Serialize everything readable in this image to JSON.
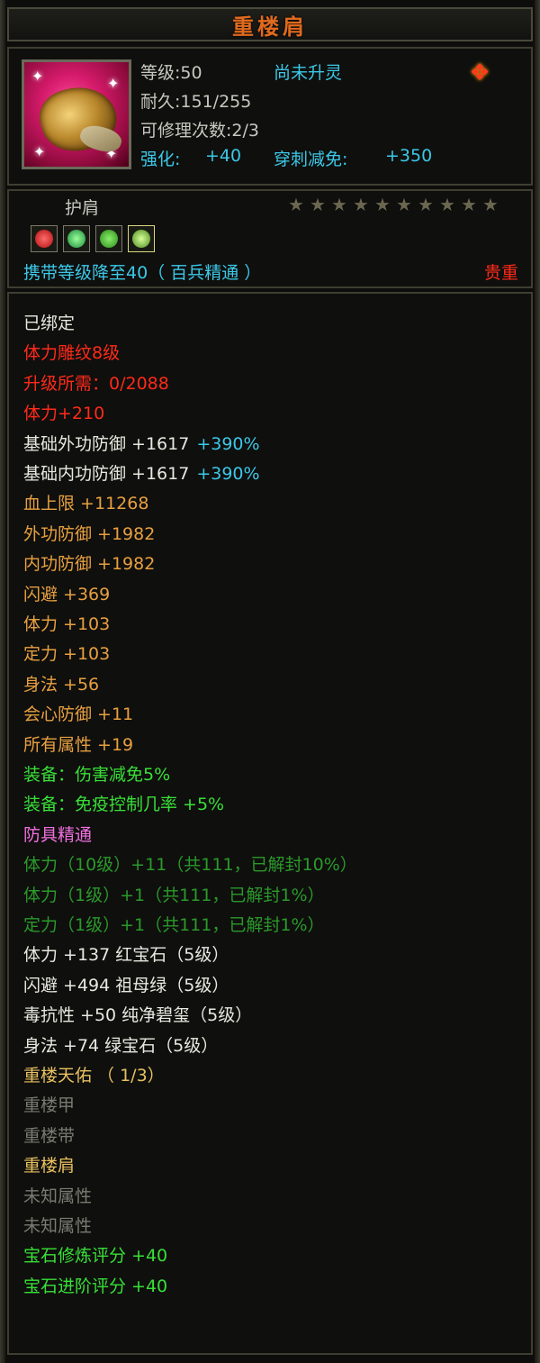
{
  "title": "重楼肩",
  "header": {
    "level_label": "等级:50",
    "spirit_status": "尚未升灵",
    "durability": "耐久:151/255",
    "repair_count": "可修理次数:2/3",
    "enhance_label": "强化:",
    "enhance_value": "+40",
    "pierce_label": "穿刺减免:",
    "pierce_value": "+350"
  },
  "slot": {
    "type_label": "护肩",
    "stars_filled": 0,
    "stars_total": 10,
    "carry_level_text": "携带等级降至40（ 百兵精通 ）",
    "rarity": "贵重",
    "gems": [
      "red-gem-icon",
      "green-gem-icon",
      "green-gem-icon",
      "jade-gem-icon"
    ]
  },
  "colors": {
    "title": "#e06a1e",
    "cyan": "#3cc8e8",
    "red": "#ff2a1a",
    "orange": "#e8a040",
    "green": "#38e038",
    "dark_green": "#2a9a2a",
    "pink": "#f070e0",
    "dim": "#7a7a72"
  },
  "attributes": [
    {
      "text": "已绑定",
      "extra": "",
      "color": "white"
    },
    {
      "text": "体力雕纹8级",
      "extra": "",
      "color": "red"
    },
    {
      "text": "升级所需：0/2088",
      "extra": "",
      "color": "red"
    },
    {
      "text": "体力+210",
      "extra": "",
      "color": "red"
    },
    {
      "text": "基础外功防御 +1617",
      "extra": "+390%",
      "color": "white"
    },
    {
      "text": "基础内功防御 +1617",
      "extra": "+390%",
      "color": "white"
    },
    {
      "text": "血上限 +11268",
      "extra": "",
      "color": "orange"
    },
    {
      "text": "外功防御 +1982",
      "extra": "",
      "color": "orange"
    },
    {
      "text": "内功防御 +1982",
      "extra": "",
      "color": "orange"
    },
    {
      "text": "闪避 +369",
      "extra": "",
      "color": "orange"
    },
    {
      "text": "体力 +103",
      "extra": "",
      "color": "orange"
    },
    {
      "text": "定力 +103",
      "extra": "",
      "color": "orange"
    },
    {
      "text": "身法 +56",
      "extra": "",
      "color": "orange"
    },
    {
      "text": "会心防御 +11",
      "extra": "",
      "color": "orange"
    },
    {
      "text": "所有属性 +19",
      "extra": "",
      "color": "orange"
    },
    {
      "text": "装备：伤害减免5%",
      "extra": "",
      "color": "green"
    },
    {
      "text": "装备：免疫控制几率 +5%",
      "extra": "",
      "color": "green"
    },
    {
      "text": "防具精通",
      "extra": "",
      "color": "pink"
    },
    {
      "text": "体力（10级）+11（共111，已解封10%）",
      "extra": "",
      "color": "dgreen"
    },
    {
      "text": "体力（1级）+1（共111，已解封1%）",
      "extra": "",
      "color": "dgreen"
    },
    {
      "text": "定力（1级）+1（共111，已解封1%）",
      "extra": "",
      "color": "dgreen"
    },
    {
      "text": "体力 +137 红宝石（5级）",
      "extra": "",
      "color": "white"
    },
    {
      "text": "闪避 +494 祖母绿（5级）",
      "extra": "",
      "color": "white"
    },
    {
      "text": "毒抗性 +50 纯净碧玺（5级）",
      "extra": "",
      "color": "white"
    },
    {
      "text": "身法 +74 绿宝石（5级）",
      "extra": "",
      "color": "white"
    },
    {
      "text": "重楼天佑 （ 1/3）",
      "extra": "",
      "color": "tan"
    },
    {
      "text": "重楼甲",
      "extra": "",
      "color": "dim"
    },
    {
      "text": "重楼带",
      "extra": "",
      "color": "dim"
    },
    {
      "text": "重楼肩",
      "extra": "",
      "color": "tan"
    },
    {
      "text": "未知属性",
      "extra": "",
      "color": "dim"
    },
    {
      "text": "未知属性",
      "extra": "",
      "color": "dim"
    },
    {
      "text": "宝石修炼评分 +40",
      "extra": "",
      "color": "green"
    },
    {
      "text": "宝石进阶评分 +40",
      "extra": "",
      "color": "green"
    }
  ]
}
